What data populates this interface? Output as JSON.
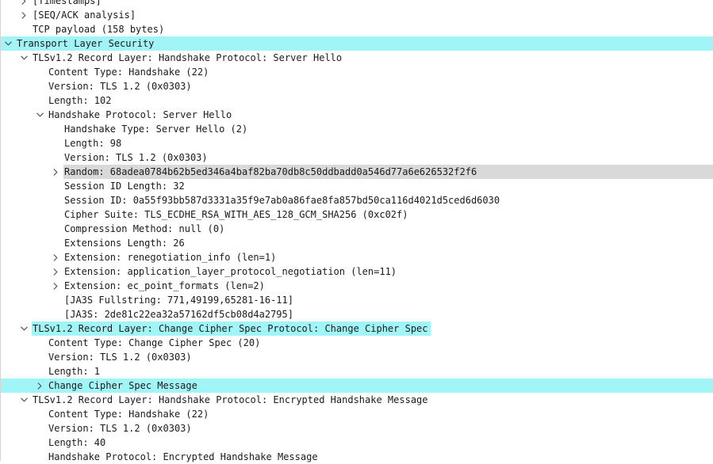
{
  "packet_details": {
    "rows": [
      {
        "level": 1,
        "toggle": "collapsed",
        "text": "[Timestamps]",
        "highlight": ""
      },
      {
        "level": 1,
        "toggle": "collapsed",
        "text": "[SEQ/ACK analysis]",
        "highlight": ""
      },
      {
        "level": 1,
        "toggle": "none",
        "text": "TCP payload (158 bytes)",
        "highlight": ""
      },
      {
        "level": 0,
        "toggle": "expanded",
        "text": "Transport Layer Security",
        "highlight": "cyan-full"
      },
      {
        "level": 1,
        "toggle": "expanded",
        "text": "TLSv1.2 Record Layer: Handshake Protocol: Server Hello",
        "highlight": ""
      },
      {
        "level": 2,
        "toggle": "none",
        "text": "Content Type: Handshake (22)",
        "highlight": ""
      },
      {
        "level": 2,
        "toggle": "none",
        "text": "Version: TLS 1.2 (0x0303)",
        "highlight": ""
      },
      {
        "level": 2,
        "toggle": "none",
        "text": "Length: 102",
        "highlight": ""
      },
      {
        "level": 2,
        "toggle": "expanded",
        "text": "Handshake Protocol: Server Hello",
        "highlight": ""
      },
      {
        "level": 3,
        "toggle": "none",
        "text": "Handshake Type: Server Hello (2)",
        "highlight": ""
      },
      {
        "level": 3,
        "toggle": "none",
        "text": "Length: 98",
        "highlight": ""
      },
      {
        "level": 3,
        "toggle": "none",
        "text": "Version: TLS 1.2 (0x0303)",
        "highlight": ""
      },
      {
        "level": 3,
        "toggle": "collapsed",
        "text": "Random: 68adea0784b62b5ed346a4baf82ba70db8c50ddbadd0a546d77a6e626532f2f6",
        "highlight": "gray-full"
      },
      {
        "level": 3,
        "toggle": "none",
        "text": "Session ID Length: 32",
        "highlight": ""
      },
      {
        "level": 3,
        "toggle": "none",
        "text": "Session ID: 0a55f93bb587d3331a35f9e7ab0a86fae8fa857bd50ca116d4021d5ced6d6030",
        "highlight": ""
      },
      {
        "level": 3,
        "toggle": "none",
        "text": "Cipher Suite: TLS_ECDHE_RSA_WITH_AES_128_GCM_SHA256 (0xc02f)",
        "highlight": ""
      },
      {
        "level": 3,
        "toggle": "none",
        "text": "Compression Method: null (0)",
        "highlight": ""
      },
      {
        "level": 3,
        "toggle": "none",
        "text": "Extensions Length: 26",
        "highlight": ""
      },
      {
        "level": 3,
        "toggle": "collapsed",
        "text": "Extension: renegotiation_info (len=1)",
        "highlight": ""
      },
      {
        "level": 3,
        "toggle": "collapsed",
        "text": "Extension: application_layer_protocol_negotiation (len=11)",
        "highlight": ""
      },
      {
        "level": 3,
        "toggle": "collapsed",
        "text": "Extension: ec_point_formats (len=2)",
        "highlight": ""
      },
      {
        "level": 3,
        "toggle": "none",
        "text": "[JA3S Fullstring: 771,49199,65281-16-11]",
        "highlight": ""
      },
      {
        "level": 3,
        "toggle": "none",
        "text": "[JA3S: 2de81c22ea32a57162df5cb08d4a2795]",
        "highlight": ""
      },
      {
        "level": 1,
        "toggle": "expanded",
        "text": "TLSv1.2 Record Layer: Change Cipher Spec Protocol: Change Cipher Spec",
        "highlight": "cyan-text"
      },
      {
        "level": 2,
        "toggle": "none",
        "text": "Content Type: Change Cipher Spec (20)",
        "highlight": ""
      },
      {
        "level": 2,
        "toggle": "none",
        "text": "Version: TLS 1.2 (0x0303)",
        "highlight": ""
      },
      {
        "level": 2,
        "toggle": "none",
        "text": "Length: 1",
        "highlight": ""
      },
      {
        "level": 2,
        "toggle": "collapsed",
        "text": "Change Cipher Spec Message",
        "highlight": "cyan-full"
      },
      {
        "level": 1,
        "toggle": "expanded",
        "text": "TLSv1.2 Record Layer: Handshake Protocol: Encrypted Handshake Message",
        "highlight": ""
      },
      {
        "level": 2,
        "toggle": "none",
        "text": "Content Type: Handshake (22)",
        "highlight": ""
      },
      {
        "level": 2,
        "toggle": "none",
        "text": "Version: TLS 1.2 (0x0303)",
        "highlight": ""
      },
      {
        "level": 2,
        "toggle": "none",
        "text": "Length: 40",
        "highlight": ""
      },
      {
        "level": 2,
        "toggle": "none",
        "text": "Handshake Protocol: Encrypted Handshake Message",
        "highlight": ""
      }
    ]
  },
  "colors": {
    "highlight_cyan": "#a2f5f7",
    "highlight_gray": "#d9d9d9",
    "text": "#1a1a1a",
    "arrow": "#555555"
  }
}
